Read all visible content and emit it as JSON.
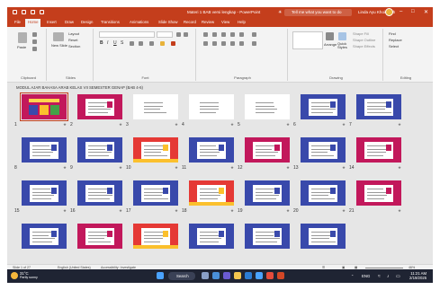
{
  "window": {
    "title": "Materi 1 BAB versi lengkap  -  PowerPoint",
    "search_placeholder": "Tell me what you want to do",
    "user_name": "Linda Ayu Khoirotiah",
    "colors": {
      "accent": "#c43e1c",
      "taskbar": "#1f2433"
    }
  },
  "tabs": [
    "File",
    "Home",
    "Insert",
    "Draw",
    "Design",
    "Transitions",
    "Animations",
    "Slide Show",
    "Record",
    "Review",
    "View",
    "Help"
  ],
  "active_tab": "Home",
  "ribbon": {
    "clipboard": {
      "label": "Clipboard",
      "paste": "Paste"
    },
    "slides": {
      "label": "Slides",
      "new_slide": "New Slide",
      "layout": "Layout",
      "reset": "Reset",
      "section": "Section"
    },
    "font": {
      "label": "Font"
    },
    "paragraph": {
      "label": "Paragraph"
    },
    "drawing": {
      "label": "Drawing",
      "arrange": "Arrange",
      "quick_styles": "Quick Styles",
      "shape_fill": "Shape Fill",
      "shape_outline": "Shape Outline",
      "shape_effects": "Shape Effects"
    },
    "editing": {
      "label": "Editing",
      "find": "Find",
      "replace": "Replace",
      "select": "Select"
    }
  },
  "section_header": "MODUL AJAR BAHASA ARAB KELAS VII SEMESTER GENAP (BAB 4-6)",
  "slides": [
    {
      "n": "1",
      "top": "#c2185b",
      "bot": "#c2185b",
      "body": "#c2185b"
    },
    {
      "n": "2",
      "top": "#c2185b",
      "bot": "#c2185b",
      "body": "#fff"
    },
    {
      "n": "3",
      "top": "#fff",
      "bot": "#fff",
      "body": "#fff"
    },
    {
      "n": "4",
      "top": "#fff",
      "bot": "#fff",
      "body": "#fff"
    },
    {
      "n": "5",
      "top": "#fff",
      "bot": "#fff",
      "body": "#fff"
    },
    {
      "n": "6",
      "top": "#3949ab",
      "bot": "#3949ab",
      "body": "#fff"
    },
    {
      "n": "7",
      "top": "#3949ab",
      "bot": "#3949ab",
      "body": "#fff"
    },
    {
      "n": "8",
      "top": "#3949ab",
      "bot": "#3949ab",
      "body": "#fff"
    },
    {
      "n": "9",
      "top": "#3949ab",
      "bot": "#3949ab",
      "body": "#fff"
    },
    {
      "n": "10",
      "top": "#e53935",
      "bot": "#fbc02d",
      "body": "#fff"
    },
    {
      "n": "11",
      "top": "#3949ab",
      "bot": "#3949ab",
      "body": "#fff"
    },
    {
      "n": "12",
      "top": "#c2185b",
      "bot": "#c2185b",
      "body": "#fff"
    },
    {
      "n": "13",
      "top": "#3949ab",
      "bot": "#3949ab",
      "body": "#fff"
    },
    {
      "n": "14",
      "top": "#c2185b",
      "bot": "#c2185b",
      "body": "#fff"
    },
    {
      "n": "15",
      "top": "#3949ab",
      "bot": "#3949ab",
      "body": "#fff"
    },
    {
      "n": "16",
      "top": "#3949ab",
      "bot": "#3949ab",
      "body": "#fff"
    },
    {
      "n": "17",
      "top": "#3949ab",
      "bot": "#3949ab",
      "body": "#fff"
    },
    {
      "n": "18",
      "top": "#e53935",
      "bot": "#fbc02d",
      "body": "#fff"
    },
    {
      "n": "19",
      "top": "#3949ab",
      "bot": "#3949ab",
      "body": "#fff"
    },
    {
      "n": "20",
      "top": "#3949ab",
      "bot": "#3949ab",
      "body": "#fff"
    },
    {
      "n": "21",
      "top": "#c2185b",
      "bot": "#c2185b",
      "body": "#fff"
    },
    {
      "n": "",
      "top": "#3949ab",
      "bot": "#3949ab",
      "body": "#fff"
    },
    {
      "n": "",
      "top": "#c2185b",
      "bot": "#c2185b",
      "body": "#fff"
    },
    {
      "n": "",
      "top": "#e53935",
      "bot": "#fbc02d",
      "body": "#fff"
    },
    {
      "n": "",
      "top": "#3949ab",
      "bot": "#3949ab",
      "body": "#fff"
    },
    {
      "n": "",
      "top": "#3949ab",
      "bot": "#3949ab",
      "body": "#fff"
    },
    {
      "n": "",
      "top": "#3949ab",
      "bot": "#3949ab",
      "body": "#fff"
    }
  ],
  "status": {
    "slide_count": "Slide 1 of 27",
    "language": "English (United States)",
    "accessibility": "Accessibility: Investigate",
    "zoom": "46%"
  },
  "taskbar": {
    "temp": "31°C",
    "weather": "Partly sunny",
    "search": "Search",
    "lang": "ENG",
    "time": "11:21 AM",
    "date": "2/19/2025"
  }
}
